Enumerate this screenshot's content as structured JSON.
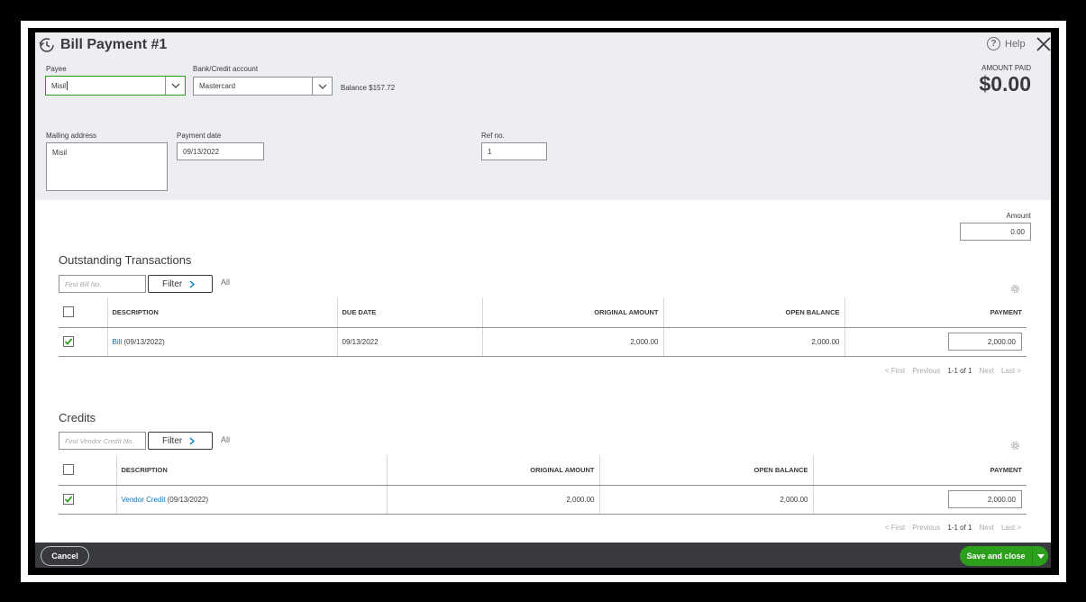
{
  "header": {
    "title": "Bill Payment #1",
    "help_label": "Help"
  },
  "form": {
    "payee_label": "Payee",
    "payee_value": "Misil",
    "bank_label": "Bank/Credit account",
    "bank_value": "Mastercard",
    "balance_text": "Balance $157.72",
    "amount_paid_label": "AMOUNT PAID",
    "amount_paid_value": "$0.00",
    "mailing_label": "Mailing address",
    "mailing_value": "Misil",
    "payment_date_label": "Payment date",
    "payment_date_value": "09/13/2022",
    "ref_label": "Ref no.",
    "ref_value": "1"
  },
  "amount_field": {
    "label": "Amount",
    "value": "0.00"
  },
  "outstanding": {
    "title": "Outstanding Transactions",
    "search_placeholder": "Find Bill No.",
    "filter_label": "Filter",
    "all_label": "All",
    "columns": [
      "DESCRIPTION",
      "DUE DATE",
      "ORIGINAL AMOUNT",
      "OPEN BALANCE",
      "PAYMENT"
    ],
    "rows": [
      {
        "checked": true,
        "desc_link": "Bill",
        "desc_rest": " (09/13/2022)",
        "due_date": "09/13/2022",
        "original": "2,000.00",
        "open": "2,000.00",
        "payment": "2,000.00"
      }
    ],
    "pager": {
      "first": "< First",
      "previous": "Previous",
      "range": "1-1 of 1",
      "next": "Next",
      "last": "Last >"
    }
  },
  "credits": {
    "title": "Credits",
    "search_placeholder": "Find Vendor Credit No.",
    "filter_label": "Filter",
    "all_label": "All",
    "columns": [
      "DESCRIPTION",
      "ORIGINAL AMOUNT",
      "OPEN BALANCE",
      "PAYMENT"
    ],
    "rows": [
      {
        "checked": true,
        "desc_link": "Vendor Credit",
        "desc_rest": " (09/13/2022)",
        "original": "2,000.00",
        "open": "2,000.00",
        "payment": "2,000.00"
      }
    ],
    "pager": {
      "first": "< First",
      "previous": "Previous",
      "range": "1-1 of 1",
      "next": "Next",
      "last": "Last >"
    }
  },
  "footer": {
    "cancel_label": "Cancel",
    "save_label": "Save and close"
  },
  "colors": {
    "primary_green": "#2ca01c",
    "link_blue": "#0077c5",
    "footer_bg": "#393a3d",
    "header_bg": "#eceef1"
  }
}
